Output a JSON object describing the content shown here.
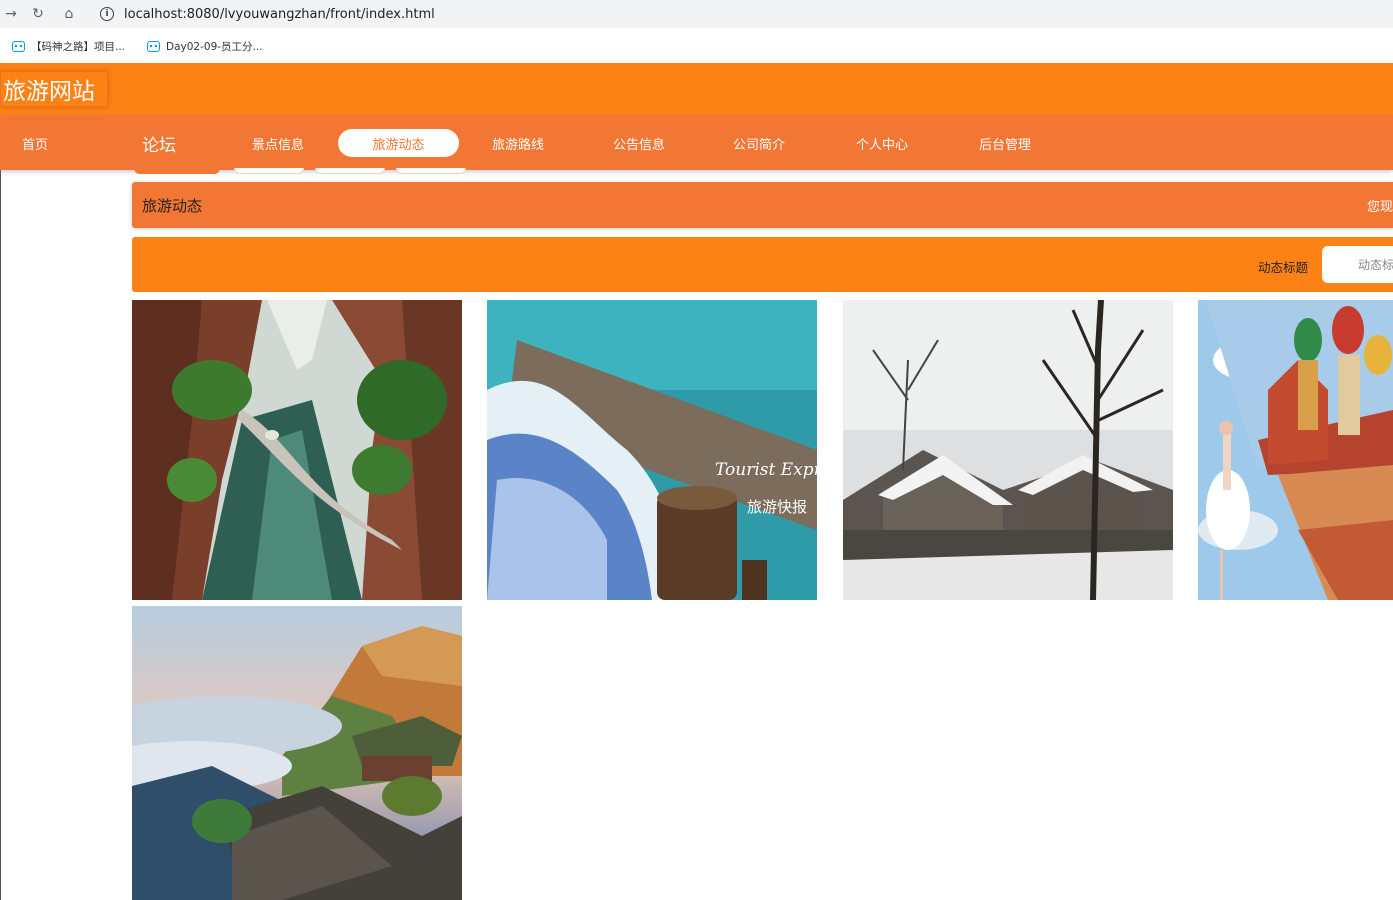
{
  "browser": {
    "url": "localhost:8080/lvyouwangzhan/front/index.html",
    "bookmarks": [
      {
        "label": "【码神之路】项目..."
      },
      {
        "label": "Day02-09-员工分..."
      }
    ]
  },
  "site": {
    "logo": "旅游网站"
  },
  "nav": {
    "items": [
      {
        "label": "首页"
      },
      {
        "label": "论坛"
      },
      {
        "label": "景点信息"
      },
      {
        "label": "旅游动态"
      },
      {
        "label": "旅游路线"
      },
      {
        "label": "公告信息"
      },
      {
        "label": "公司简介"
      },
      {
        "label": "个人中心"
      },
      {
        "label": "后台管理"
      }
    ],
    "active": "旅游动态"
  },
  "section": {
    "title": "旅游动态",
    "right_text": "您现"
  },
  "search": {
    "label": "动态标题",
    "placeholder": "动态标"
  },
  "gallery": {
    "items": [
      {
        "image": "canyon-river-cliff"
      },
      {
        "image": "waterfall-tourist-express",
        "overlay_en": "Tourist Express",
        "overlay_cn": "旅游快报"
      },
      {
        "image": "snowy-stone-village"
      },
      {
        "image": "russia-cathedral-dancer"
      },
      {
        "image": "mountain-sea-of-clouds-temple"
      }
    ]
  },
  "colors": {
    "header": "#fd8216",
    "navbar": "#f37734",
    "white": "#ffffff"
  }
}
